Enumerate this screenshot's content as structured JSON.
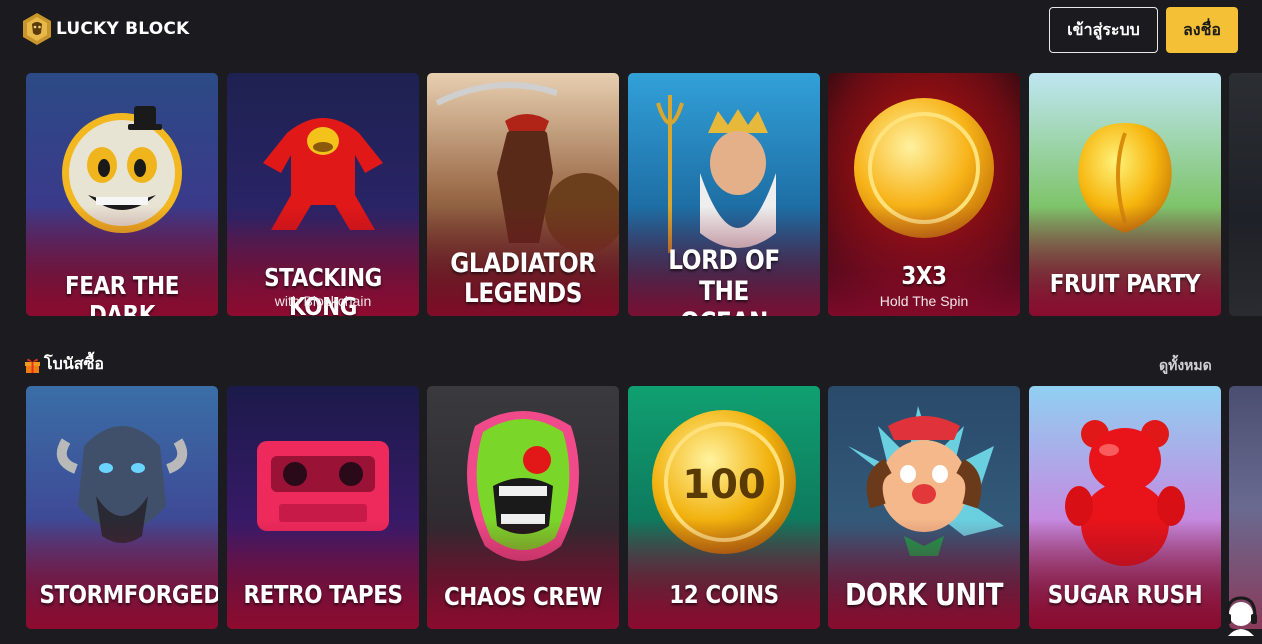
{
  "header": {
    "brand": "LUCKY BLOCK",
    "login_label": "เข้าสู่ระบบ",
    "register_label": "ลงชื่อ",
    "accent_color": "#f4c035"
  },
  "row_1": {
    "games": [
      {
        "title": "FEAR THE DARK",
        "subtitle": ""
      },
      {
        "title": "STACKING KONG",
        "subtitle": "with Blockchain"
      },
      {
        "title": "GLADIATOR\nLEGENDS",
        "subtitle": ""
      },
      {
        "title": "LORD OF THE\nOCEAN",
        "subtitle": ""
      },
      {
        "title": "3X3",
        "subtitle": "Hold The Spin"
      },
      {
        "title": "FRUIT PARTY",
        "subtitle": ""
      }
    ]
  },
  "section_bonus": {
    "icon": "gift-icon",
    "title": "โบนัสซื้อ",
    "view_all": "ดูทั้งหมด"
  },
  "row_2": {
    "games": [
      {
        "title": "STORMFORGED",
        "subtitle": ""
      },
      {
        "title": "RETRO TAPES",
        "subtitle": ""
      },
      {
        "title": "CHAOS CREW",
        "subtitle": ""
      },
      {
        "title": "12 COINS",
        "subtitle": ""
      },
      {
        "title": "DORK UNIT",
        "subtitle": ""
      },
      {
        "title": "SUGAR RUSH",
        "subtitle": ""
      }
    ]
  },
  "support_widget": {
    "icon": "headset-support-icon"
  }
}
